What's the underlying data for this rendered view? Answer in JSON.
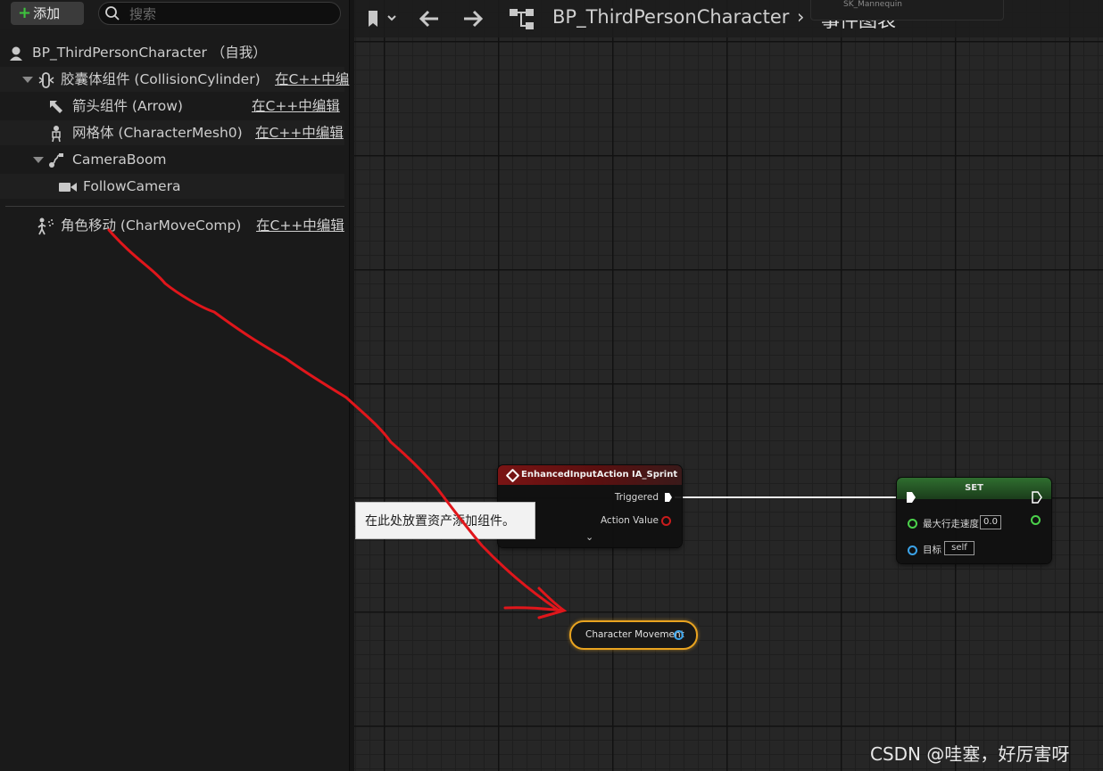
{
  "components_panel": {
    "add_label": "添加",
    "search_placeholder": "搜索",
    "items": [
      {
        "label": "BP_ThirdPersonCharacter （自我）",
        "link": ""
      },
      {
        "label": "胶囊体组件 (CollisionCylinder)",
        "link": "在C++中编"
      },
      {
        "label": "箭头组件 (Arrow)",
        "link": "在C++中编辑"
      },
      {
        "label": "网格体 (CharacterMesh0)",
        "link": "在C++中编辑"
      },
      {
        "label": "CameraBoom",
        "link": ""
      },
      {
        "label": "FollowCamera",
        "link": ""
      },
      {
        "label": "角色移动 (CharMoveComp)",
        "link": "在C++中编辑"
      }
    ]
  },
  "graph_toolbar": {
    "breadcrumb_root": "BP_ThirdPersonCharacter",
    "breadcrumb_separator": "›",
    "breadcrumb_current": "事件图表",
    "overlay_text": "SK_Mannequin"
  },
  "event_node": {
    "title": "EnhancedInputAction IA_Sprint",
    "pin_triggered": "Triggered",
    "pin_action_value": "Action Value"
  },
  "set_node": {
    "title": "SET",
    "pin_speed_label": "最大行走速度",
    "speed_value": "0.0",
    "pin_target_label": "目标",
    "target_value": "self"
  },
  "charmove_node": {
    "label": "Character Movement"
  },
  "tooltip": {
    "text": "在此处放置资产添加组件。"
  },
  "watermark": "CSDN @哇塞，好厉害呀",
  "colors": {
    "accent_green": "#3ec43e",
    "event_red": "#7a1414",
    "set_green": "#2f6e2f",
    "object_blue": "#3ba3e8",
    "float_green": "#4bd14b",
    "selection_orange": "#e8a320",
    "annotation_red": "#e0161b"
  }
}
